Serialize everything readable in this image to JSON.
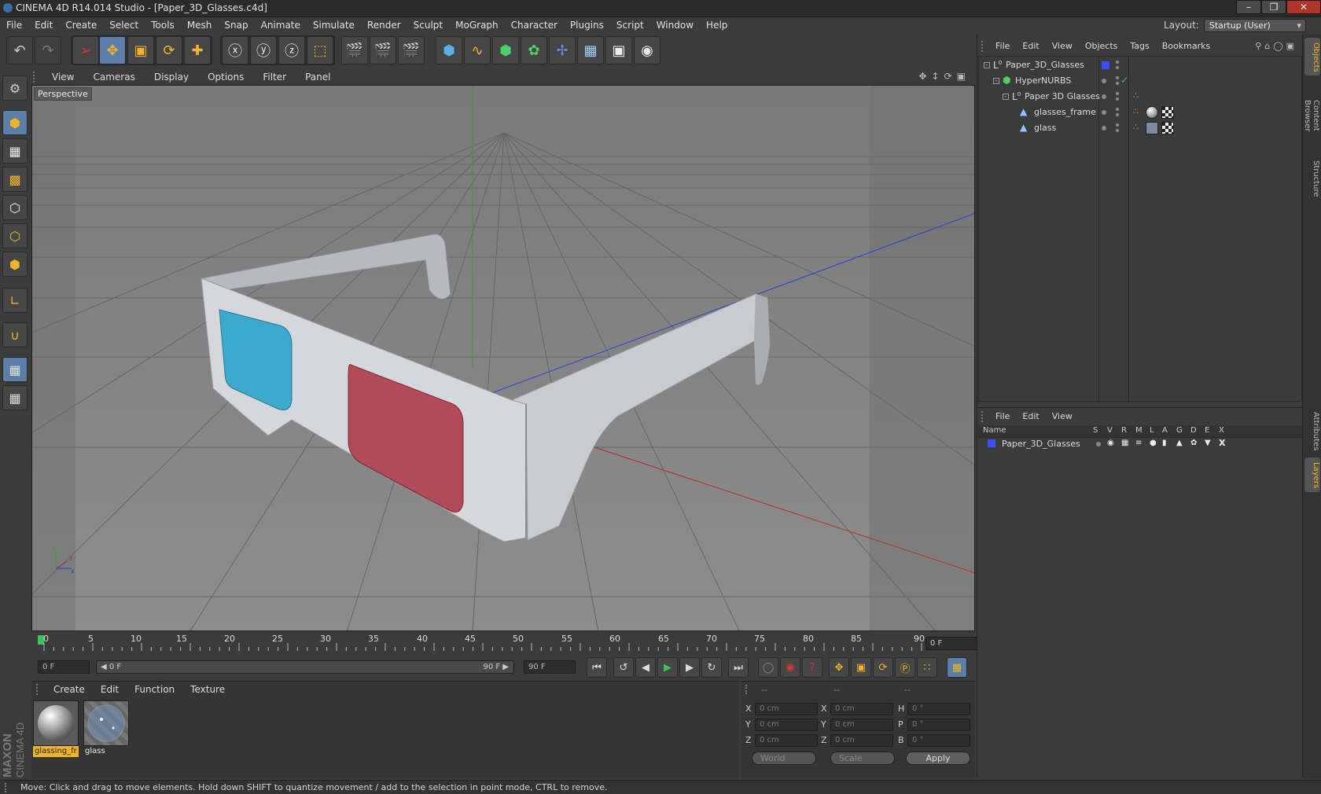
{
  "window": {
    "title": "CINEMA 4D R14.014 Studio - [Paper_3D_Glasses.c4d]"
  },
  "menu": [
    "File",
    "Edit",
    "Create",
    "Select",
    "Tools",
    "Mesh",
    "Snap",
    "Animate",
    "Simulate",
    "Render",
    "Sculpt",
    "MoGraph",
    "Character",
    "Plugins",
    "Script",
    "Window",
    "Help"
  ],
  "layout": {
    "label": "Layout:",
    "value": "Startup (User)"
  },
  "viewport": {
    "menu": [
      "View",
      "Cameras",
      "Display",
      "Options",
      "Filter",
      "Panel"
    ],
    "label": "Perspective"
  },
  "timeline": {
    "ticks": [
      "0",
      "5",
      "10",
      "15",
      "20",
      "25",
      "30",
      "35",
      "40",
      "45",
      "50",
      "55",
      "60",
      "65",
      "70",
      "75",
      "80",
      "85",
      "90"
    ],
    "current_frame": "0 F",
    "start_field": "0 F",
    "range_start": "◀ 0 F",
    "range_end": "90 F ▶",
    "end_field": "90 F"
  },
  "materials": {
    "menu": [
      "Create",
      "Edit",
      "Function",
      "Texture"
    ],
    "items": [
      {
        "name": "glassing_fr",
        "selected": true
      },
      {
        "name": "glass",
        "selected": false
      }
    ]
  },
  "coordinates": {
    "headers": [
      "--",
      "--",
      "--"
    ],
    "rows": [
      {
        "a": "X",
        "av": "0 cm",
        "b": "X",
        "bv": "0 cm",
        "c": "H",
        "cv": "0 °"
      },
      {
        "a": "Y",
        "av": "0 cm",
        "b": "Y",
        "bv": "0 cm",
        "c": "P",
        "cv": "0 °"
      },
      {
        "a": "Z",
        "av": "0 cm",
        "b": "Z",
        "bv": "0 cm",
        "c": "B",
        "cv": "0 °"
      }
    ],
    "world": "World",
    "scale": "Scale",
    "apply": "Apply"
  },
  "objects": {
    "menu": [
      "File",
      "Edit",
      "View",
      "Objects",
      "Tags",
      "Bookmarks"
    ],
    "tree": [
      {
        "name": "Paper_3D_Glasses",
        "level": 0,
        "icon": "null-icon"
      },
      {
        "name": "HyperNURBS",
        "level": 1,
        "icon": "hypernurbs-icon"
      },
      {
        "name": "Paper 3D Glasses",
        "level": 2,
        "icon": "null-icon"
      },
      {
        "name": "glasses_frame",
        "level": 3,
        "icon": "polygon-icon"
      },
      {
        "name": "glass",
        "level": 3,
        "icon": "polygon-icon"
      }
    ]
  },
  "layers": {
    "menu": [
      "File",
      "Edit",
      "View"
    ],
    "columns": [
      "Name",
      "S",
      "V",
      "R",
      "M",
      "L",
      "A",
      "G",
      "D",
      "E",
      "X"
    ],
    "row": "Paper_3D_Glasses"
  },
  "side_tabs": [
    "Objects",
    "Content Browser",
    "Structure",
    "Attributes",
    "Layers"
  ],
  "brand": {
    "line1": "MAXON",
    "line2": "CINEMA 4D"
  },
  "status": "Move: Click and drag to move elements. Hold down SHIFT to quantize movement / add to the selection in point mode, CTRL to remove.",
  "colors": {
    "accent": "#f0b429",
    "selection": "#5b7fa8",
    "layer": "#3a4fff"
  }
}
